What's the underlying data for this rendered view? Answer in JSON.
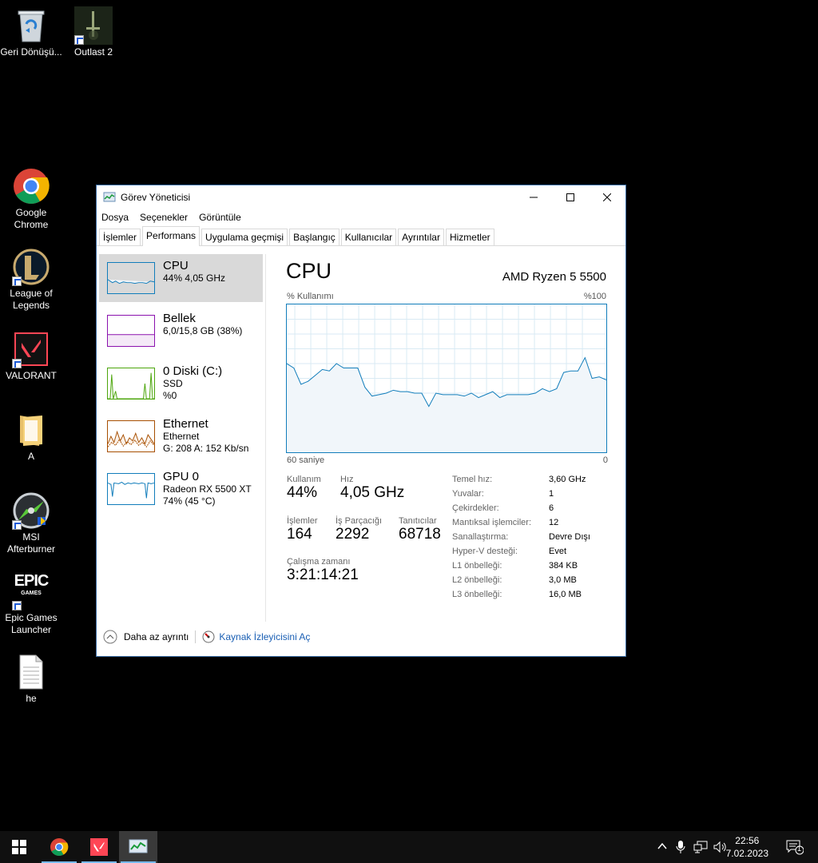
{
  "desktop": {
    "icons": [
      {
        "label": "Geri Dönüşü..."
      },
      {
        "label": "Outlast 2"
      },
      {
        "label": "Google Chrome"
      },
      {
        "label": "League of Legends"
      },
      {
        "label": "VALORANT"
      },
      {
        "label": "A"
      },
      {
        "label": "MSI Afterburner"
      },
      {
        "label": "Epic Games Launcher"
      },
      {
        "label": "he"
      }
    ],
    "epic_logo": "EPIC",
    "epic_sub": "GAMES"
  },
  "window": {
    "title": "Görev Yöneticisi",
    "menu": [
      "Dosya",
      "Seçenekler",
      "Görüntüle"
    ],
    "tabs": [
      "İşlemler",
      "Performans",
      "Uygulama geçmişi",
      "Başlangıç",
      "Kullanıcılar",
      "Ayrıntılar",
      "Hizmetler"
    ],
    "devices": [
      {
        "name": "CPU",
        "line1": "44% 4,05 GHz",
        "line2": "",
        "color": "#117dbb"
      },
      {
        "name": "Bellek",
        "line1": "6,0/15,8 GB (38%)",
        "line2": "",
        "color": "#8b12ae"
      },
      {
        "name": "0 Diski (C:)",
        "line1": "SSD",
        "line2": "%0",
        "color": "#4da60c"
      },
      {
        "name": "Ethernet",
        "line1": "Ethernet",
        "line2": "G: 208 A: 152 Kb/sn",
        "color": "#a74f01"
      },
      {
        "name": "GPU 0",
        "line1": "Radeon RX 5500 XT",
        "line2": "74% (45 °C)",
        "color": "#117dbb"
      }
    ],
    "cpu": {
      "title": "CPU",
      "model": "AMD Ryzen 5 5500",
      "usage_label": "% Kullanımı",
      "max_label": "%100",
      "time_label": "60 saniye",
      "zero_label": "0",
      "graph_color": "#117dbb",
      "graph_fill": "#f1f6fa",
      "graph_values": [
        60,
        57,
        46,
        48,
        52,
        56,
        55,
        60,
        57,
        57,
        57,
        44,
        38,
        39,
        40,
        42,
        41,
        41,
        40,
        40,
        31,
        40,
        39,
        39,
        39,
        38,
        40,
        37,
        39,
        41,
        37,
        39,
        39,
        39,
        39,
        40,
        43,
        41,
        43,
        54,
        55,
        55,
        64,
        50,
        51,
        49
      ],
      "usage_title": "Kullanım",
      "usage_value": "44%",
      "speed_title": "Hız",
      "speed_value": "4,05 GHz",
      "processes_title": "İşlemler",
      "processes_value": "164",
      "threads_title": "İş Parçacığı",
      "threads_value": "2292",
      "handles_title": "Tanıtıcılar",
      "handles_value": "68718",
      "uptime_title": "Çalışma zamanı",
      "uptime_value": "3:21:14:21",
      "specs": [
        {
          "k": "Temel hız:",
          "v": "3,60 GHz"
        },
        {
          "k": "Yuvalar:",
          "v": "1"
        },
        {
          "k": "Çekirdekler:",
          "v": "6"
        },
        {
          "k": "Mantıksal işlemciler:",
          "v": "12"
        },
        {
          "k": "Sanallaştırma:",
          "v": "Devre Dışı"
        },
        {
          "k": "Hyper-V desteği:",
          "v": "Evet"
        },
        {
          "k": "L1 önbelleği:",
          "v": "384 KB"
        },
        {
          "k": "L2 önbelleği:",
          "v": "3,0 MB"
        },
        {
          "k": "L3 önbelleği:",
          "v": "16,0 MB"
        }
      ]
    },
    "footer": {
      "fewer_details": "Daha az ayrıntı",
      "resource_monitor": "Kaynak İzleyicisini Aç"
    }
  },
  "taskbar": {
    "time": "22:56",
    "date": "7.02.2023",
    "notif_count": "1"
  }
}
